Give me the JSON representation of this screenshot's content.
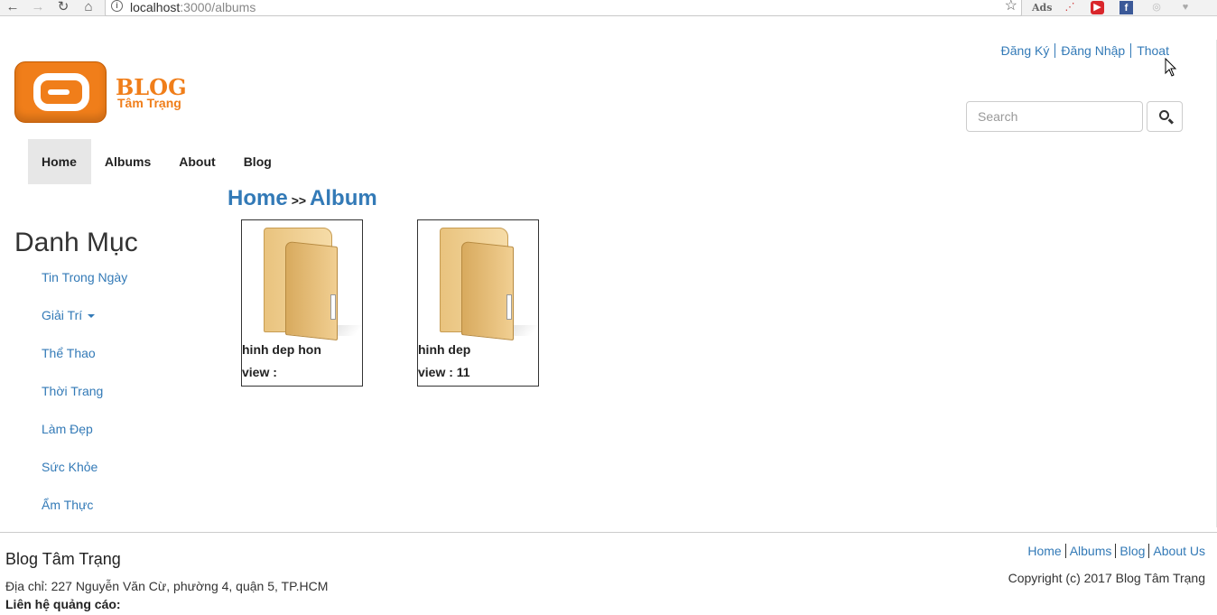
{
  "browser": {
    "url_host": "localhost",
    "url_path": ":3000/albums"
  },
  "header": {
    "top_links": [
      "Đăng Ký",
      "Đăng Nhập",
      "Thoat"
    ],
    "logo_title": "BLOG",
    "logo_subtitle": "Tâm Trạng",
    "search_placeholder": "Search"
  },
  "navbar": {
    "items": [
      "Home",
      "Albums",
      "About",
      "Blog"
    ],
    "active": "Home"
  },
  "sidebar": {
    "title": "Danh Mục",
    "items": [
      "Tin Trong Ngày",
      "Giải Trí",
      "Thể Thao",
      "Thời Trang",
      "Làm Đẹp",
      "Sức Khỏe",
      "Ẩm Thực"
    ]
  },
  "breadcrumb": {
    "home": "Home",
    "separator": ">>",
    "current": "Album"
  },
  "albums": [
    {
      "name": "hinh dep hon",
      "views": "view :"
    },
    {
      "name": "hinh dep",
      "views": "view : 11"
    }
  ],
  "footer": {
    "title": "Blog Tâm Trạng",
    "address": "Địa chỉ: 227 Nguyễn Văn Cừ, phường 4, quận 5, TP.HCM",
    "contact": "Liên hệ quảng cáo:",
    "links": [
      "Home",
      "Albums",
      "Blog",
      "About Us"
    ],
    "copyright": "Copyright (c) 2017 Blog Tâm Trạng"
  },
  "colors": {
    "link": "#337ab7",
    "brand": "#f07e1a",
    "nav_active_bg": "#e7e7e7"
  }
}
